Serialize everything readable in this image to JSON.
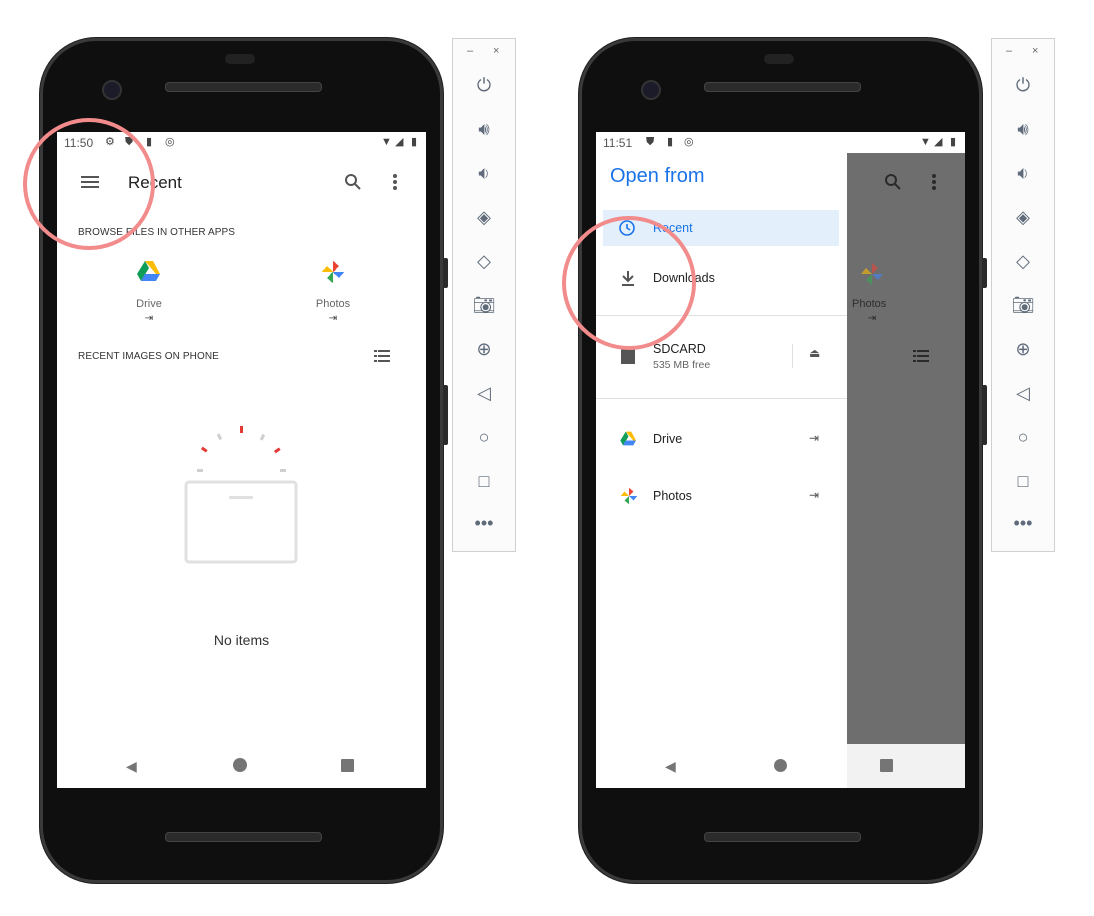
{
  "left_phone": {
    "status": {
      "time": "11:50"
    },
    "appbar": {
      "title": "Recent"
    },
    "browse_caption": "BROWSE FILES IN OTHER APPS",
    "apps": [
      {
        "label": "Drive"
      },
      {
        "label": "Photos"
      }
    ],
    "recent_caption": "RECENT IMAGES ON PHONE",
    "empty_text": "No items"
  },
  "right_phone": {
    "status": {
      "time": "11:51"
    },
    "drawer": {
      "title": "Open from",
      "items": [
        {
          "label": "Recent"
        },
        {
          "label": "Downloads"
        },
        {
          "label": "SDCARD",
          "sublabel": "535 MB free"
        },
        {
          "label": "Drive"
        },
        {
          "label": "Photos"
        }
      ]
    },
    "bg_app_label": "Photos"
  },
  "emulator_toolbar": {
    "minimize": "–",
    "close": "×",
    "buttons": [
      "power-icon",
      "volume-up-icon",
      "volume-down-icon",
      "rotate-left-icon",
      "rotate-right-icon",
      "camera-icon",
      "zoom-icon",
      "back-icon",
      "home-icon",
      "overview-icon",
      "more-icon"
    ]
  },
  "colors": {
    "accent": "#1a73e8",
    "highlight_ring": "#f28b8b",
    "drawer_selected": "#e3f0fc"
  }
}
